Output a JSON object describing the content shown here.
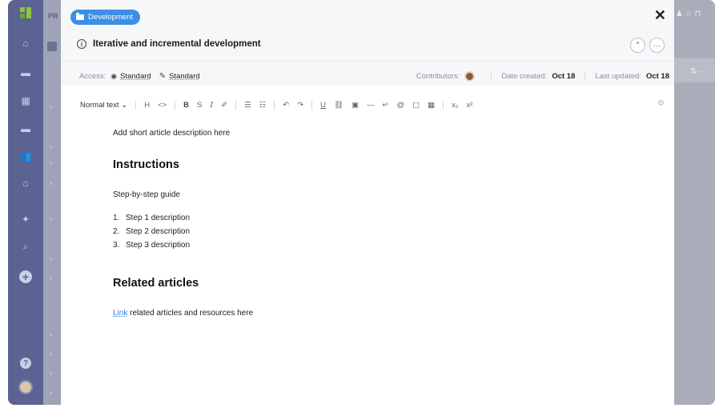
{
  "app": {
    "background_label": "PR"
  },
  "tag": {
    "label": "Development",
    "color": "#3d8ee6"
  },
  "article": {
    "title": "Iterative and incremental development",
    "info_icon_glyph": "ⓘ"
  },
  "meta": {
    "access_label": "Access:",
    "view_access": "Standard",
    "edit_access": "Standard",
    "contributors_label": "Contributors:",
    "date_created_label": "Date created:",
    "date_created": "Oct 18",
    "last_updated_label": "Last updated:",
    "last_updated": "Oct 18"
  },
  "toolbar": {
    "text_style": "Normal text",
    "items": [
      "H",
      "<>",
      "B",
      "S",
      "I",
      "✐",
      "☰",
      "☷",
      "↶",
      "↷",
      "U",
      "🔗",
      "▣",
      "—",
      "↵",
      "@",
      "▢",
      "▦",
      "x₂",
      "x²"
    ]
  },
  "body": {
    "description": "Add short article description here",
    "instructions_heading": "Instructions",
    "instructions_intro": "Step-by-step guide",
    "steps": [
      "Step 1 description",
      "Step 2 description",
      "Step 3 description"
    ],
    "related_heading": "Related articles",
    "related_link": "Link",
    "related_text": " related articles and resources here"
  },
  "icons": {
    "close": "✕",
    "collapse": "⌃",
    "more": "···",
    "view": "👁",
    "edit": "✎",
    "gear": "⚙"
  }
}
